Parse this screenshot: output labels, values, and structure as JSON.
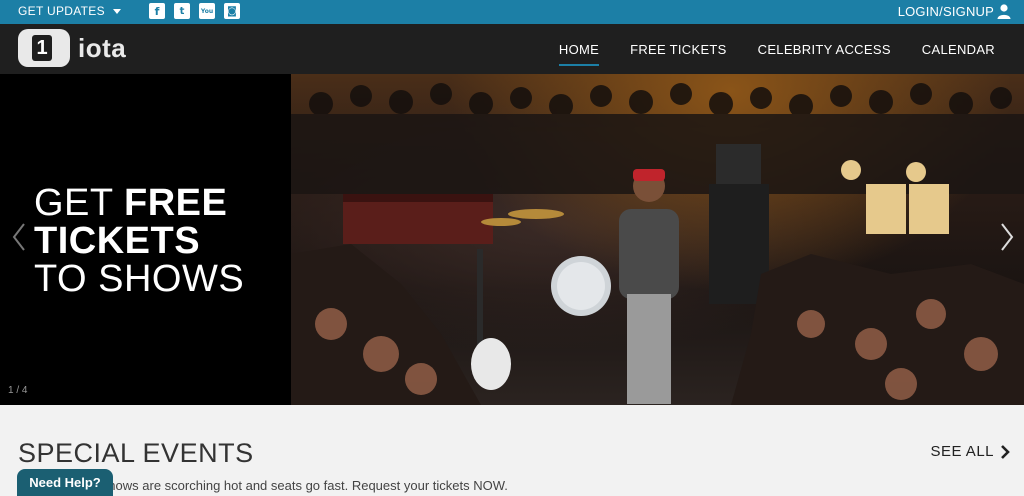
{
  "topbar": {
    "updates_label": "GET UPDATES",
    "social": [
      {
        "icon": "facebook-icon",
        "glyph": "f"
      },
      {
        "icon": "twitter-icon",
        "glyph": "t"
      },
      {
        "icon": "youtube-icon",
        "glyph": "You"
      },
      {
        "icon": "instagram-icon",
        "glyph": "◙"
      }
    ],
    "login_label": "LOGIN/SIGNUP"
  },
  "nav": {
    "logo_number": "1",
    "logo_text": "iota",
    "items": [
      {
        "label": "HOME",
        "active": true
      },
      {
        "label": "FREE TICKETS",
        "active": false
      },
      {
        "label": "CELEBRITY ACCESS",
        "active": false
      },
      {
        "label": "CALENDAR",
        "active": false
      }
    ]
  },
  "hero": {
    "headline_line1_a": "GET ",
    "headline_line1_b": "FREE",
    "headline_line2": "TICKETS",
    "headline_line3": "TO SHOWS",
    "pager": "1 / 4"
  },
  "events": {
    "title": "SPECIAL EVENTS",
    "see_all": "SEE ALL",
    "subtext": "hese shows are scorching hot and seats go fast. Request your tickets NOW."
  },
  "help": {
    "label": "Need Help?"
  },
  "colors": {
    "accent": "#1c7fa6",
    "nav_bg": "#1f1f1f",
    "help_bg": "#1b5f72"
  }
}
